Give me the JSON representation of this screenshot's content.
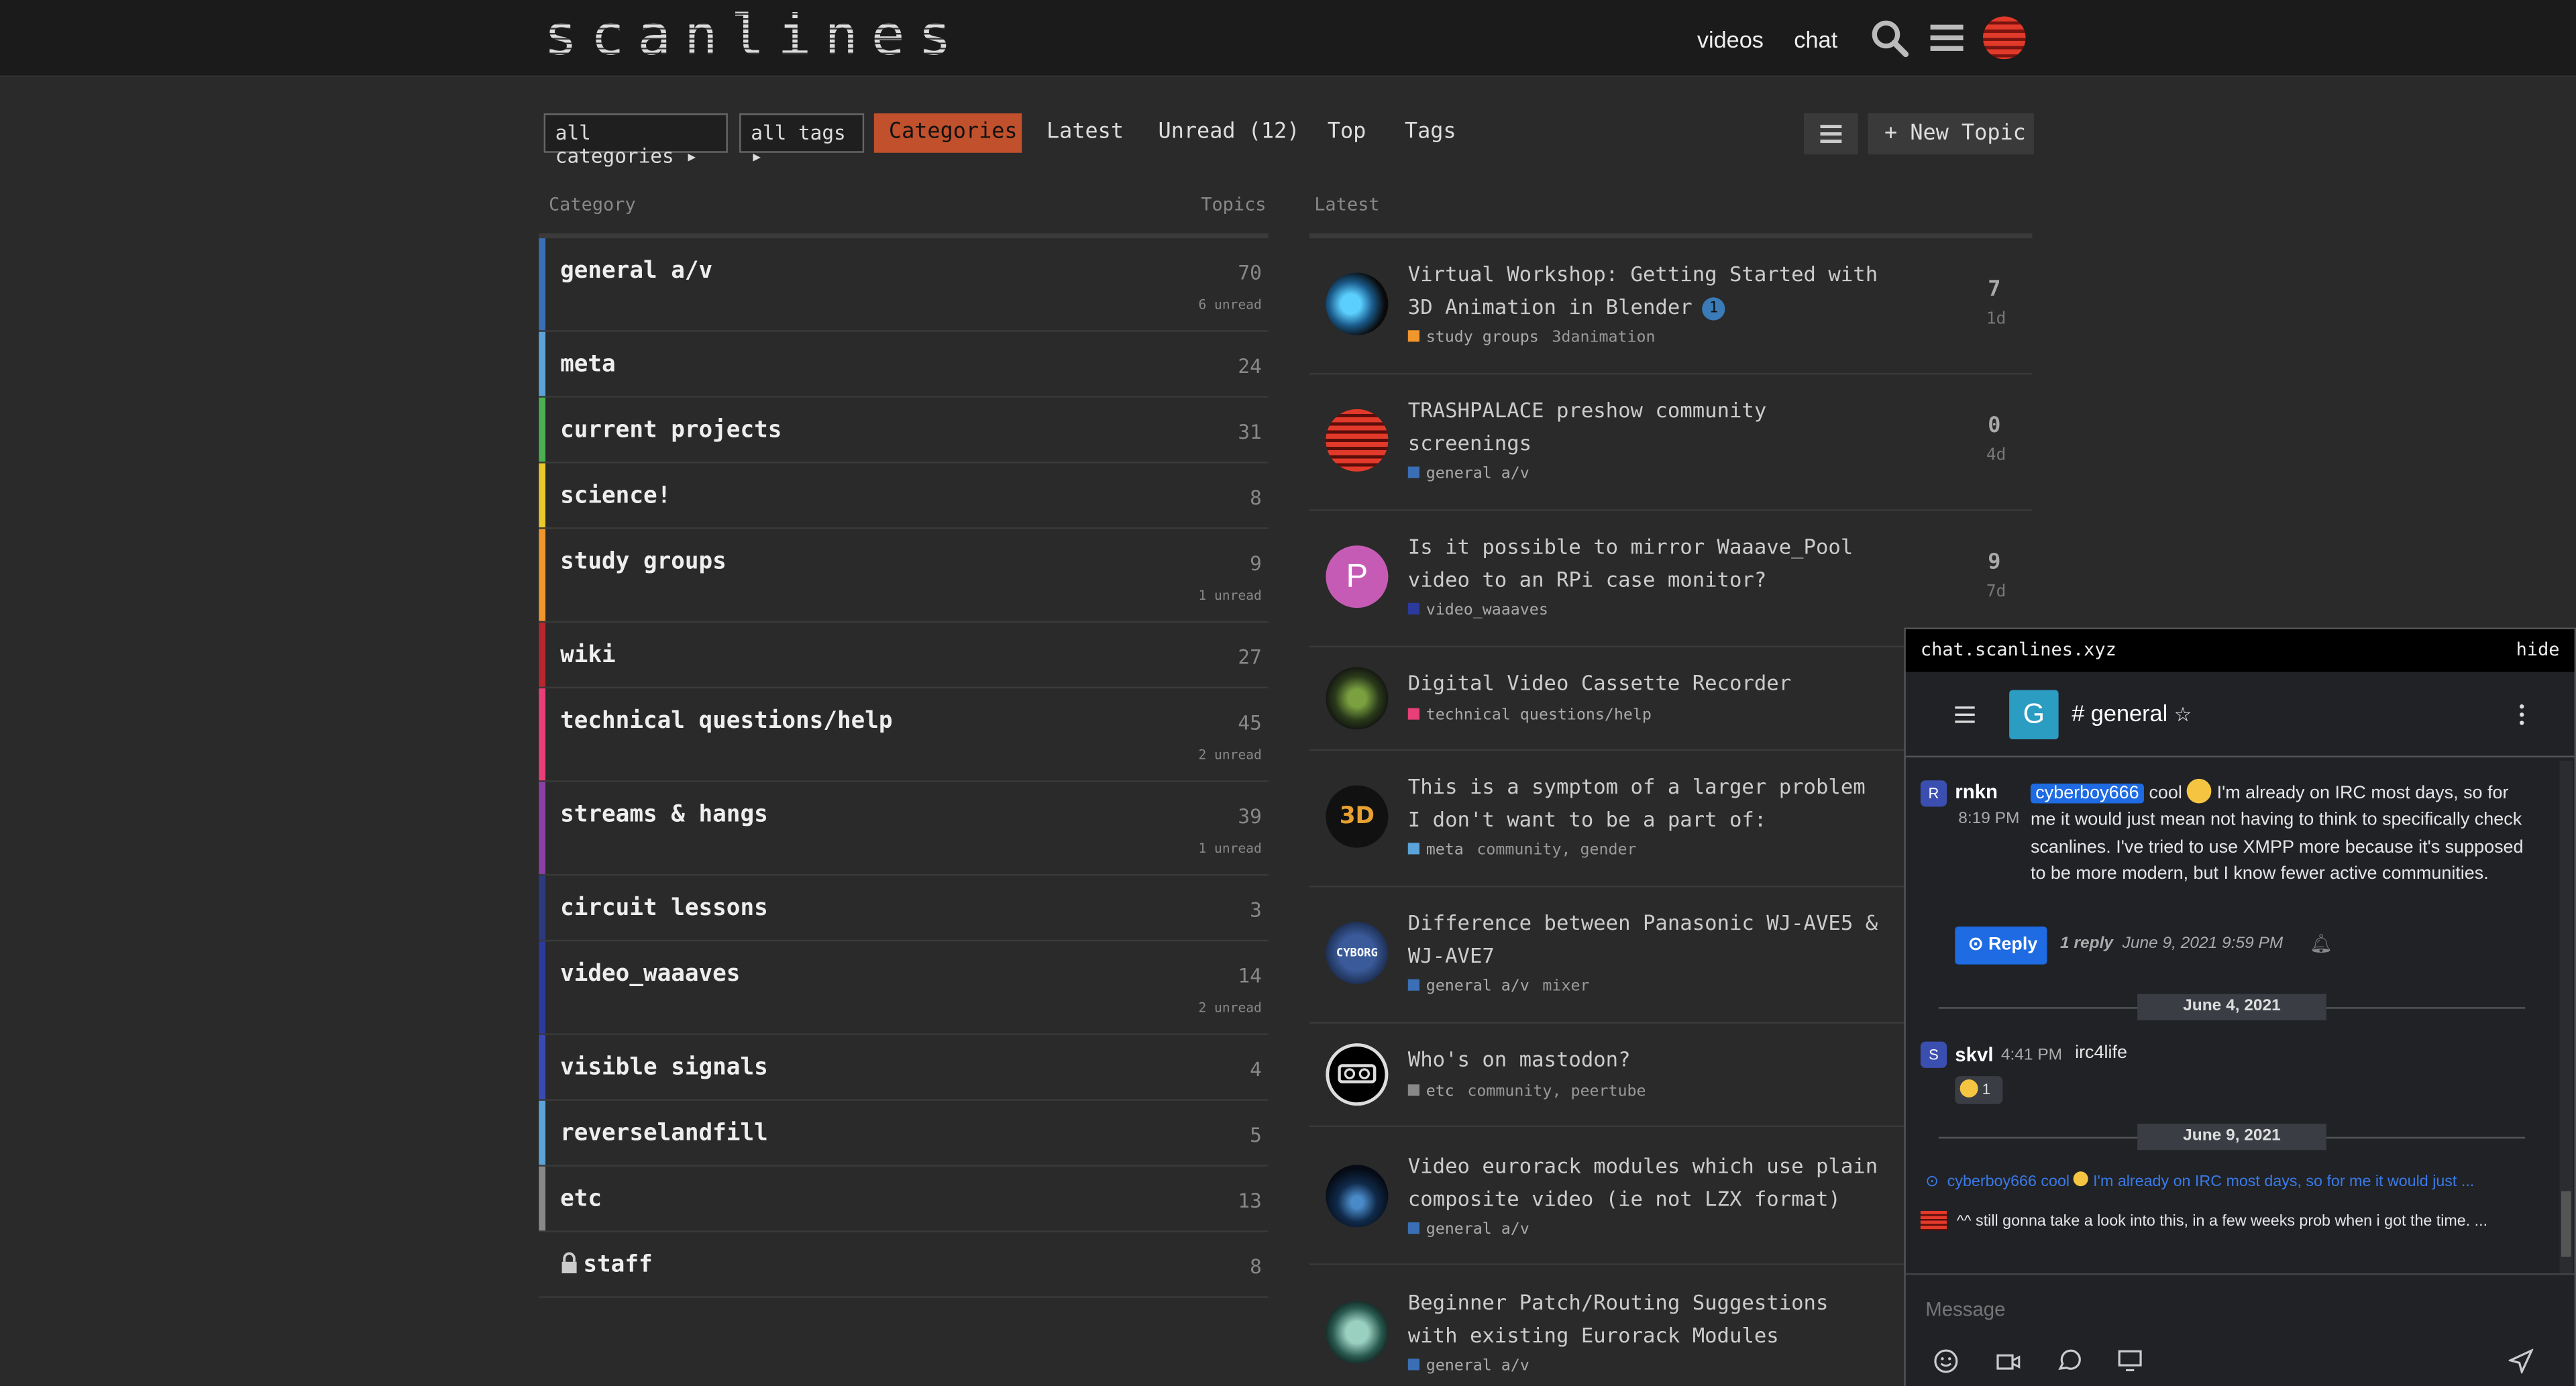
{
  "header": {
    "logo": "scanlines",
    "links": [
      "videos",
      "chat"
    ]
  },
  "nav": {
    "category_filter": "all categories",
    "tag_filter": "all tags",
    "tabs": [
      "Categories",
      "Latest",
      "Unread (12)",
      "Top",
      "Tags"
    ],
    "active_tab": "Categories",
    "new_topic": "New Topic"
  },
  "columns": {
    "category": "Category",
    "topics": "Topics",
    "latest": "Latest"
  },
  "categories": [
    {
      "name": "general a/v",
      "count": "70",
      "unread": "6 unread",
      "color": "#3a6fb5"
    },
    {
      "name": "meta",
      "count": "24",
      "unread": "",
      "color": "#5ba3d9"
    },
    {
      "name": "current projects",
      "count": "31",
      "unread": "",
      "color": "#4caf50"
    },
    {
      "name": "science!",
      "count": "8",
      "unread": "",
      "color": "#e8c82a"
    },
    {
      "name": "study groups",
      "count": "9",
      "unread": "1 unread",
      "color": "#f0962d"
    },
    {
      "name": "wiki",
      "count": "27",
      "unread": "",
      "color": "#b8272d"
    },
    {
      "name": "technical questions/help",
      "count": "45",
      "unread": "2 unread",
      "color": "#e83f78"
    },
    {
      "name": "streams & hangs",
      "count": "39",
      "unread": "1 unread",
      "color": "#8a3fa5"
    },
    {
      "name": "circuit lessons",
      "count": "3",
      "unread": "",
      "color": "#2c3a7e"
    },
    {
      "name": "video_waaaves",
      "count": "14",
      "unread": "2 unread",
      "color": "#2c3a9e"
    },
    {
      "name": "visible signals",
      "count": "4",
      "unread": "",
      "color": "#3a4ab5"
    },
    {
      "name": "reverselandfill",
      "count": "5",
      "unread": "",
      "color": "#5ba3d9"
    },
    {
      "name": "etc",
      "count": "13",
      "unread": "",
      "color": "#888888"
    },
    {
      "name": "staff",
      "count": "8",
      "unread": "",
      "color": "#2a2a2a"
    }
  ],
  "topics": [
    {
      "title": "Virtual Workshop: Getting Started with 3D Animation in Blender",
      "badge": "1",
      "category": "study groups",
      "category_color": "#f0962d",
      "tags": "3danimation",
      "replies": "7",
      "age": "1d"
    },
    {
      "title": "TRASHPALACE preshow community screenings",
      "badge": "",
      "category": "general a/v",
      "category_color": "#3a6fb5",
      "tags": "",
      "replies": "0",
      "age": "4d"
    },
    {
      "title": "Is it possible to mirror Waaave_Pool video to an RPi case monitor?",
      "badge": "",
      "category": "video_waaaves",
      "category_color": "#2c3a9e",
      "tags": "",
      "replies": "9",
      "age": "7d"
    },
    {
      "title": "Digital Video Cassette Recorder",
      "badge": "",
      "category": "technical questions/help",
      "category_color": "#e83f78",
      "tags": "",
      "replies": "",
      "age": ""
    },
    {
      "title": "This is a symptom of a larger problem I don't want to be a part of:",
      "badge": "",
      "category": "meta",
      "category_color": "#5ba3d9",
      "tags": "community, gender",
      "replies": "",
      "age": ""
    },
    {
      "title": "Difference between Panasonic WJ-AVE5 & WJ-AVE7",
      "badge": "",
      "category": "general a/v",
      "category_color": "#3a6fb5",
      "tags": "mixer",
      "replies": "",
      "age": ""
    },
    {
      "title": "Who's on mastodon?",
      "badge": "",
      "category": "etc",
      "category_color": "#888888",
      "tags": "community, peertube",
      "replies": "",
      "age": ""
    },
    {
      "title": "Video eurorack modules which use plain composite video (ie not LZX format)",
      "badge": "",
      "category": "general a/v",
      "category_color": "#3a6fb5",
      "tags": "",
      "replies": "",
      "age": ""
    },
    {
      "title": "Beginner Patch/Routing Suggestions with existing Eurorack Modules",
      "badge": "",
      "category": "general a/v",
      "category_color": "#3a6fb5",
      "tags": "",
      "replies": "",
      "age": ""
    }
  ],
  "chat": {
    "host": "chat.scanlines.xyz",
    "hide": "hide",
    "room_initial": "G",
    "room": "general",
    "msg1": {
      "initial": "R",
      "user": "rnkn",
      "time": "8:19 PM",
      "mention": "cyberboy666",
      "text_before": "cool",
      "text": "I'm already on IRC most days, so for me it would just mean not having to think to specifically check scanlines. I've tried to use XMPP more because it's supposed to be more modern, but I know fewer active communities.",
      "reply_label": "Reply",
      "reply_count": "1 reply",
      "reply_time": "June 9, 2021 9:59 PM"
    },
    "date1": "June 4, 2021",
    "msg2": {
      "initial": "S",
      "user": "skvl",
      "time": "4:41 PM",
      "text": "irc4life",
      "reaction_count": "1"
    },
    "date2": "June 9, 2021",
    "thread_preview": {
      "mention": "cyberboy666",
      "word": "cool",
      "text": "I'm already on IRC most days, so for me it would just ..."
    },
    "last_msg": "^^ still gonna take a look into this, in a few weeks prob when i got the time. ...",
    "input_placeholder": "Message"
  }
}
